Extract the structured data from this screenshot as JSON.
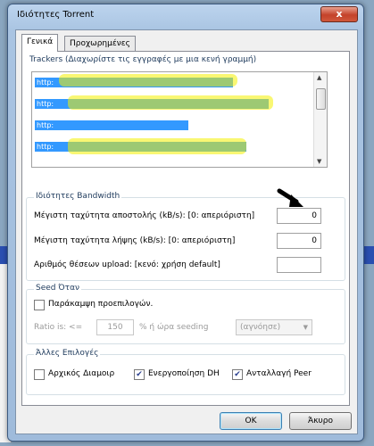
{
  "window": {
    "title": "Ιδιότητες Torrent",
    "close_label": "x"
  },
  "tabs": [
    {
      "label": "Γενικά",
      "active": true
    },
    {
      "label": "Προχωρημένες",
      "active": false
    }
  ],
  "trackers": {
    "title": "Trackers (Διαχωρίστε τις εγγραφές με μια κενή γραμμή)",
    "lines": [
      "http:",
      "http:",
      "http:",
      "http:"
    ]
  },
  "bandwidth": {
    "title": "Ιδιότητες Bandwidth",
    "upload_label": "Μέγιστη ταχύτητα αποστολής (kB/s): [0: απεριόριστη]",
    "upload_value": "0",
    "download_label": "Μέγιστη ταχύτητα λήψης (kB/s): [0: απεριόριστη]",
    "download_value": "0",
    "slots_label": "Αριθμός θέσεων upload: [κενό: χρήση default]",
    "slots_value": ""
  },
  "seed": {
    "title": "Seed Όταν",
    "override_label": "Παράκαμψη προεπιλογών.",
    "override_checked": false,
    "ratio_label": "Ratio is:  <=",
    "ratio_value": "150",
    "percent_label": "%  ή ώρα seeding",
    "time_value": "(αγνόησε)"
  },
  "other": {
    "title": "Άλλες Επιλογές",
    "initial_seed_label": "Αρχικός Διαμοιρ",
    "initial_seed_checked": false,
    "dht_label": "Ενεργοποίηση DH",
    "dht_checked": true,
    "pex_label": "Ανταλλαγή Peer",
    "pex_checked": true
  },
  "buttons": {
    "ok": "OK",
    "cancel": "Άκυρο"
  },
  "colors": {
    "selection": "#3399ff",
    "scribble": "#f4f000"
  }
}
